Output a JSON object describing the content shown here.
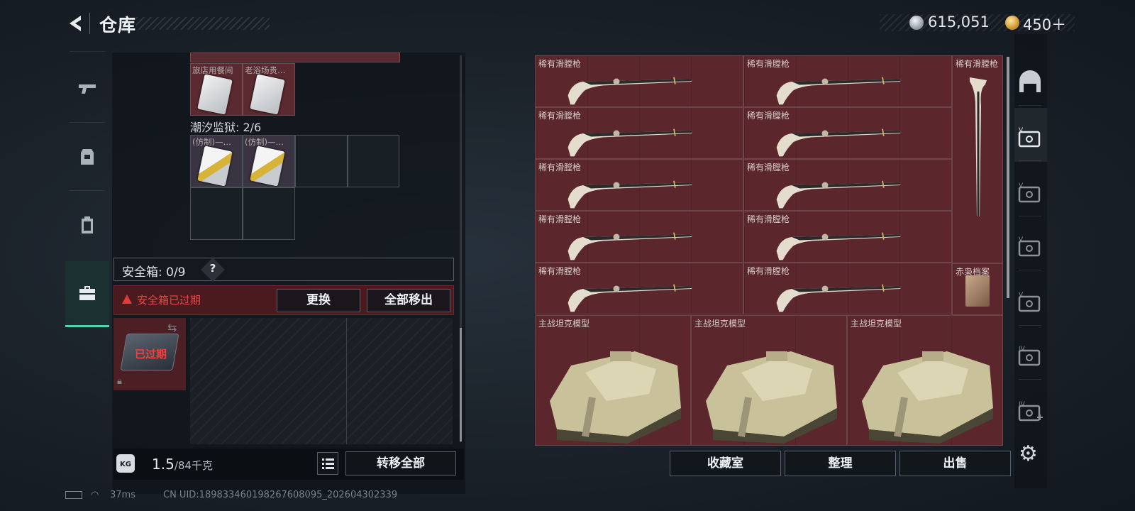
{
  "header": {
    "title": "仓库",
    "currency_silver": "615,051",
    "currency_gold": "450＋"
  },
  "left_tabs": [
    {
      "name": "weapons",
      "icon": "pistol-icon"
    },
    {
      "name": "armor",
      "icon": "armor-icon"
    },
    {
      "name": "backpack",
      "icon": "backpack-icon"
    },
    {
      "name": "safe-box",
      "icon": "briefcase-icon",
      "active": true
    }
  ],
  "stash": {
    "top_slots": [
      {
        "label": "旅店用餐间"
      },
      {
        "label": "老浴场贵…"
      }
    ],
    "prison_label": "潮汐监狱: 2/6",
    "prison_slots": [
      {
        "label": "(仿制)—…"
      },
      {
        "label": "(仿制)—…"
      }
    ]
  },
  "safe_box": {
    "label": "安全箱: 0/9",
    "help": "?",
    "expired_warning": "安全箱已过期",
    "replace_label": "更换",
    "remove_all_label": "全部移出",
    "case_status": "已过期"
  },
  "footer_left": {
    "kg_icon": "KG",
    "weight_value": "1.5",
    "weight_max": "/84千克",
    "transfer_all_label": "转移全部"
  },
  "inventory": {
    "musket_label": "稀有滑膛枪",
    "archive_label": "赤枭档案",
    "tank_label": "主战坦克模型",
    "collection_label": "收藏室",
    "sort_label": "整理",
    "sell_label": "出售"
  },
  "right_sidebar": [
    {
      "icon": "helmet-icon"
    },
    {
      "icon": "case-v-icon",
      "active": true
    },
    {
      "icon": "case-v-icon"
    },
    {
      "icon": "case-v-icon"
    },
    {
      "icon": "case-v-icon"
    },
    {
      "icon": "case-iv-icon"
    },
    {
      "icon": "case-iv-add-icon"
    }
  ],
  "status_bar": {
    "ping": "37ms",
    "uid": "CN UID:18983346019826760​8095_202604302339"
  }
}
